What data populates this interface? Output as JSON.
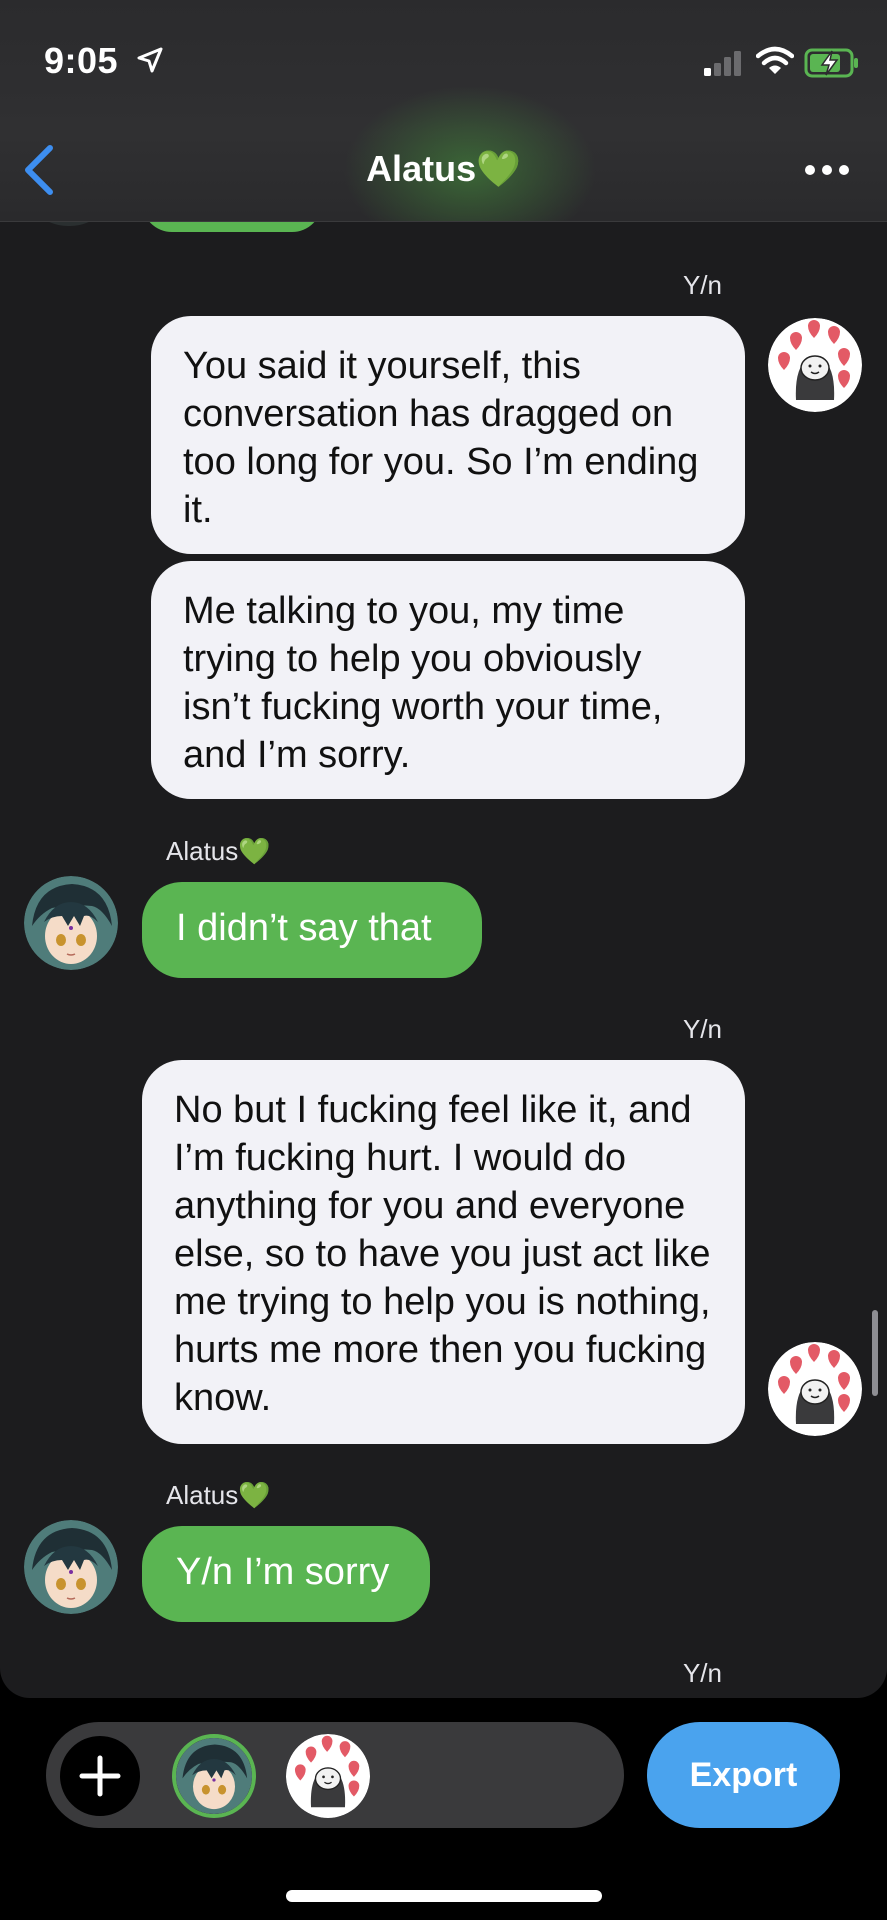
{
  "status_bar": {
    "time": "9:05"
  },
  "header": {
    "title": "Alatus💚"
  },
  "messages": [
    {
      "sender": "Y/n",
      "lines": "You said it yourself, this conversation has dragged on too long for you. So I’m ending it."
    },
    {
      "sender": "Y/n",
      "lines": "Me talking to you, my time trying to help you obviously isn’t fucking worth your time, and I’m sorry."
    },
    {
      "sender": "Alatus💚",
      "lines": "I didn’t say that"
    },
    {
      "sender": "Y/n",
      "lines": "No but I fucking feel like it, and I’m fucking hurt. I would do anything for you and everyone else, so to have you just act like me trying to help you is nothing, hurts me more then you fucking know."
    },
    {
      "sender": "Alatus💚",
      "lines": "Y/n I’m sorry"
    },
    {
      "sender": "Y/n",
      "lines": ""
    }
  ],
  "names": {
    "yn": "Y/n",
    "alatus": "Alatus💚"
  },
  "toolbar": {
    "export_label": "Export"
  },
  "colors": {
    "green_bubble": "#5ab552",
    "gray_bubble": "#f2f2f7",
    "export_blue": "#4aa3ee",
    "background": "#1c1c1e"
  }
}
